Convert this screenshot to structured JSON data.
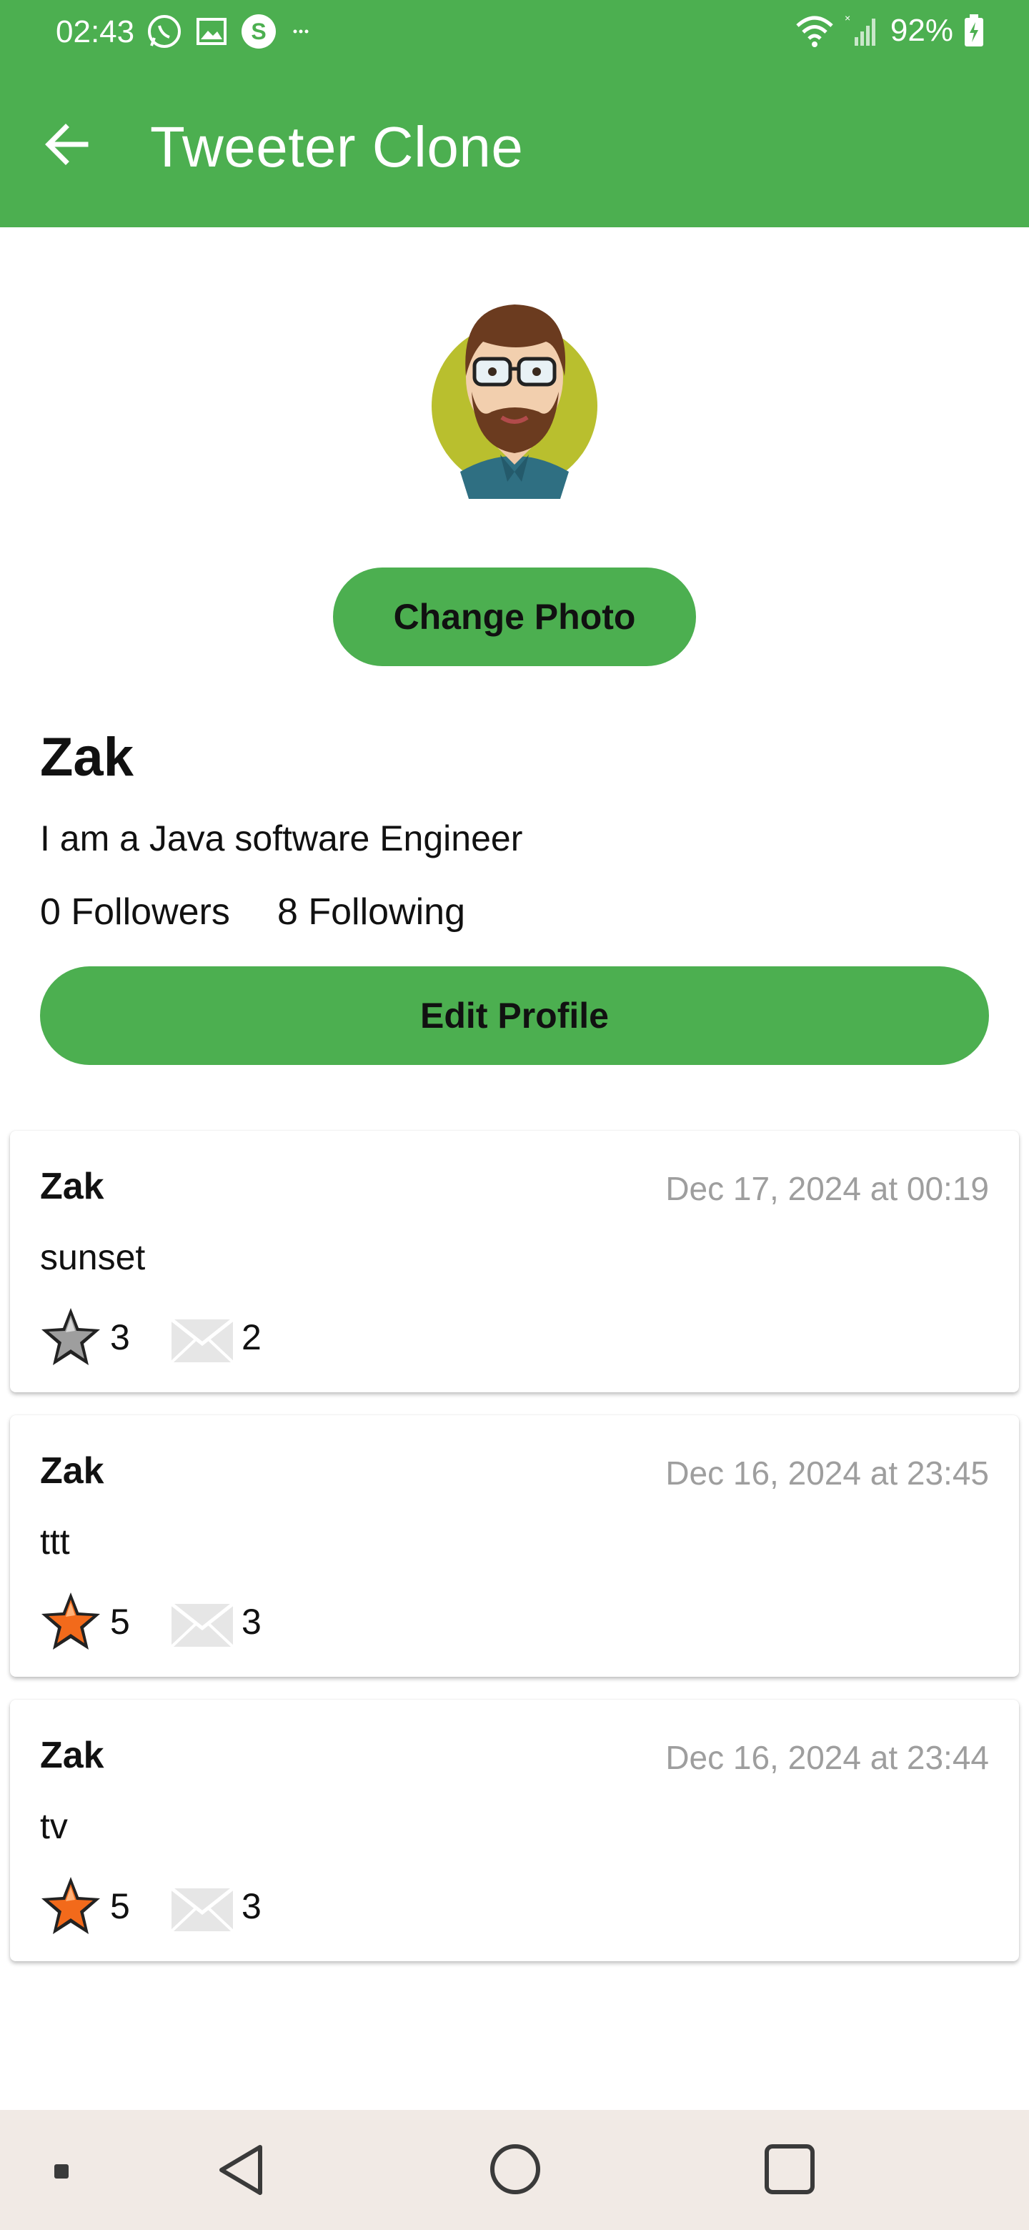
{
  "status_bar": {
    "time": "02:43",
    "battery": "92%"
  },
  "app_bar": {
    "title": "Tweeter Clone"
  },
  "profile": {
    "change_photo_label": "Change Photo",
    "name": "Zak",
    "bio": "I am a Java software Engineer",
    "followers": "0 Followers",
    "following": "8 Following",
    "edit_profile_label": "Edit Profile"
  },
  "tweets": [
    {
      "author": "Zak",
      "date": "Dec 17, 2024 at 00:19",
      "text": "sunset",
      "likes": "3",
      "replies": "2",
      "liked": false
    },
    {
      "author": "Zak",
      "date": "Dec 16, 2024 at 23:45",
      "text": "ttt",
      "likes": "5",
      "replies": "3",
      "liked": true
    },
    {
      "author": "Zak",
      "date": "Dec 16, 2024 at 23:44",
      "text": "tv",
      "likes": "5",
      "replies": "3",
      "liked": true
    }
  ],
  "colors": {
    "accent": "#4caf50",
    "star_active": "#f26a1b",
    "star_inactive": "#9e9e9e",
    "date_text": "#9e9e9e",
    "nav_background": "#f1eae5"
  },
  "icons": {
    "back": "arrow-left-icon",
    "like": "star-icon",
    "reply": "envelope-icon",
    "nav_recent": "square-dot-icon",
    "nav_back": "triangle-back-icon",
    "nav_home": "circle-home-icon",
    "nav_overview": "square-overview-icon"
  }
}
